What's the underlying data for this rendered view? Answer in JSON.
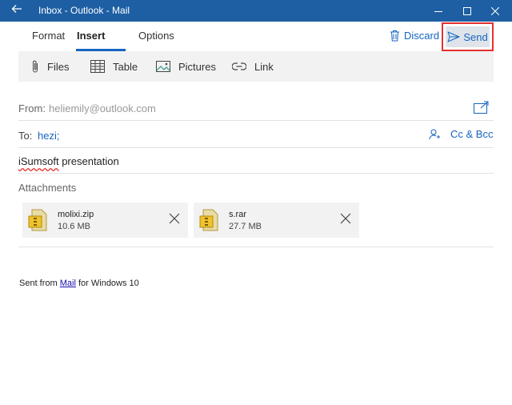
{
  "window": {
    "title": "Inbox - Outlook - Mail"
  },
  "tabs": [
    {
      "label": "Format"
    },
    {
      "label": "Insert"
    },
    {
      "label": "Options"
    }
  ],
  "actions": {
    "discard_label": "Discard",
    "send_label": "Send"
  },
  "toolbar": {
    "files": "Files",
    "table": "Table",
    "pictures": "Pictures",
    "link": "Link"
  },
  "from": {
    "label": "From:",
    "value": "heliemily@outlook.com"
  },
  "to": {
    "label": "To:",
    "value": "hezi;",
    "ccbcc_label": "Cc & Bcc"
  },
  "subject": {
    "text_misspelled": "iSumsoft",
    "text_rest": " presentation"
  },
  "attachments": {
    "label": "Attachments",
    "items": [
      {
        "name": "molixi.zip",
        "size": "10.6 MB"
      },
      {
        "name": "s.rar",
        "size": "27.7 MB"
      }
    ]
  },
  "body": {
    "sent_prefix": "Sent from ",
    "sent_link": "Mail",
    "sent_suffix": " for Windows 10"
  },
  "colors": {
    "titlebar": "#1e5fa3",
    "accent": "#1565c0",
    "highlight_border": "#e53030"
  }
}
